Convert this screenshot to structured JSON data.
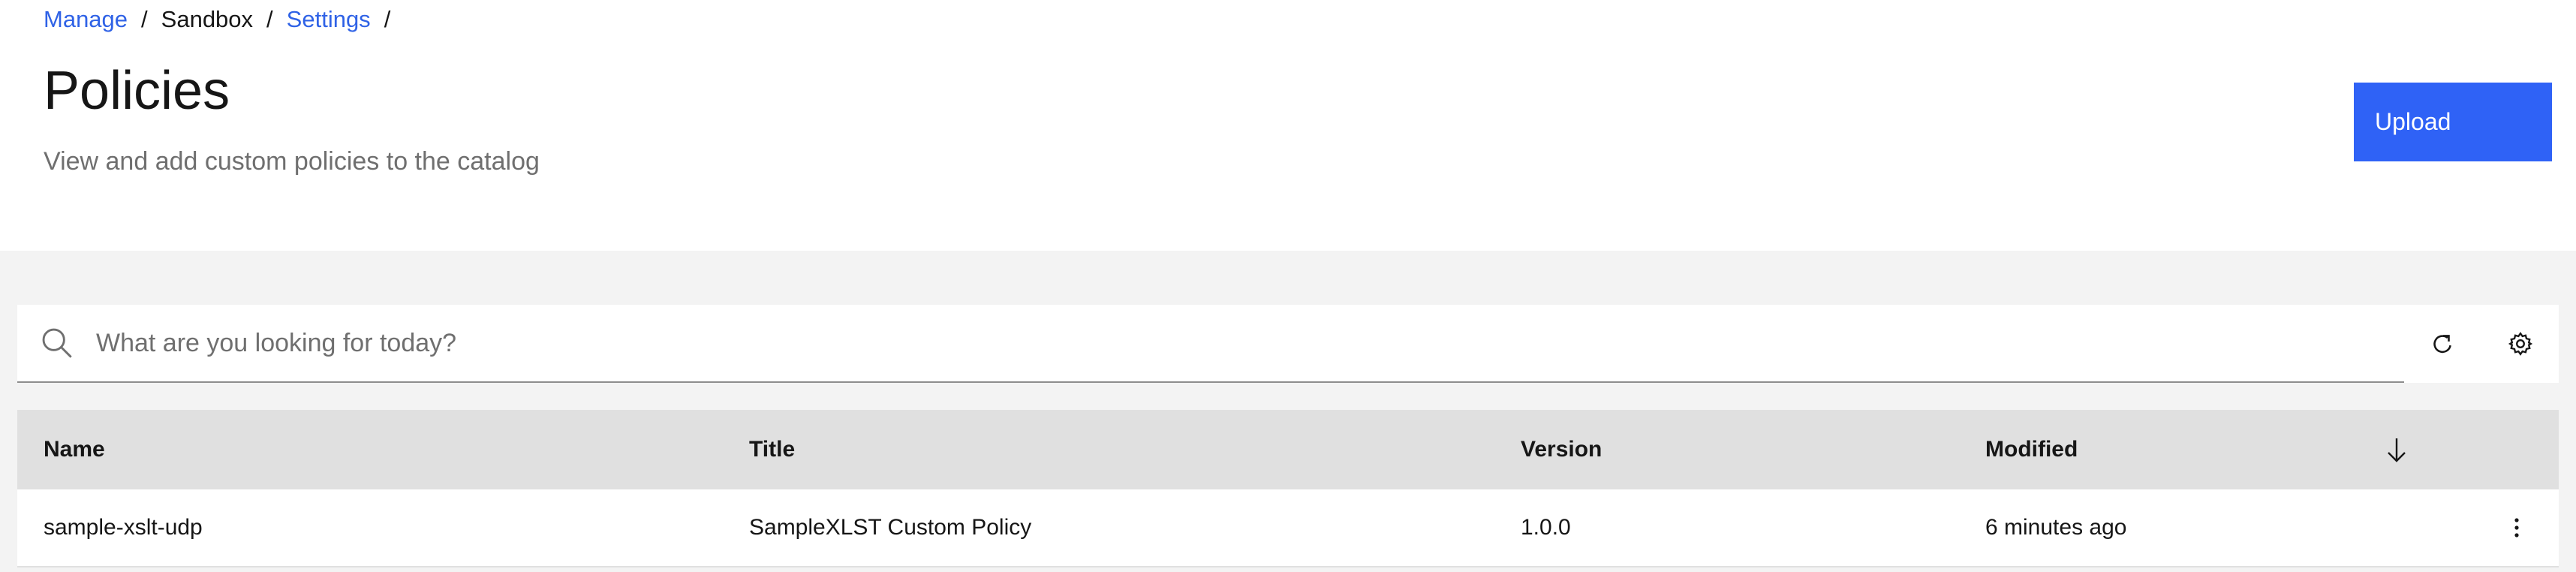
{
  "breadcrumb": {
    "items": [
      {
        "label": "Manage",
        "link": true
      },
      {
        "label": "Sandbox",
        "link": false
      },
      {
        "label": "Settings",
        "link": true
      }
    ],
    "separator": "/"
  },
  "page": {
    "title": "Policies",
    "subtitle": "View and add custom policies to the catalog"
  },
  "actions": {
    "upload_label": "Upload"
  },
  "search": {
    "placeholder": "What are you looking for today?",
    "value": ""
  },
  "toolbar": {
    "icons": [
      "search-icon",
      "refresh-icon",
      "settings-icon"
    ]
  },
  "table": {
    "columns": {
      "name": "Name",
      "title": "Title",
      "version": "Version",
      "modified": "Modified"
    },
    "sort_icon": "arrow-down-icon",
    "rows": [
      {
        "name": "sample-xslt-udp",
        "title": "SampleXLST Custom Policy",
        "version": "1.0.0",
        "modified": "6 minutes ago"
      }
    ]
  },
  "colors": {
    "primary": "#2f62f6",
    "link": "#2f62e6",
    "page_background": "#f3f3f3",
    "table_header": "#e0e0e0"
  }
}
